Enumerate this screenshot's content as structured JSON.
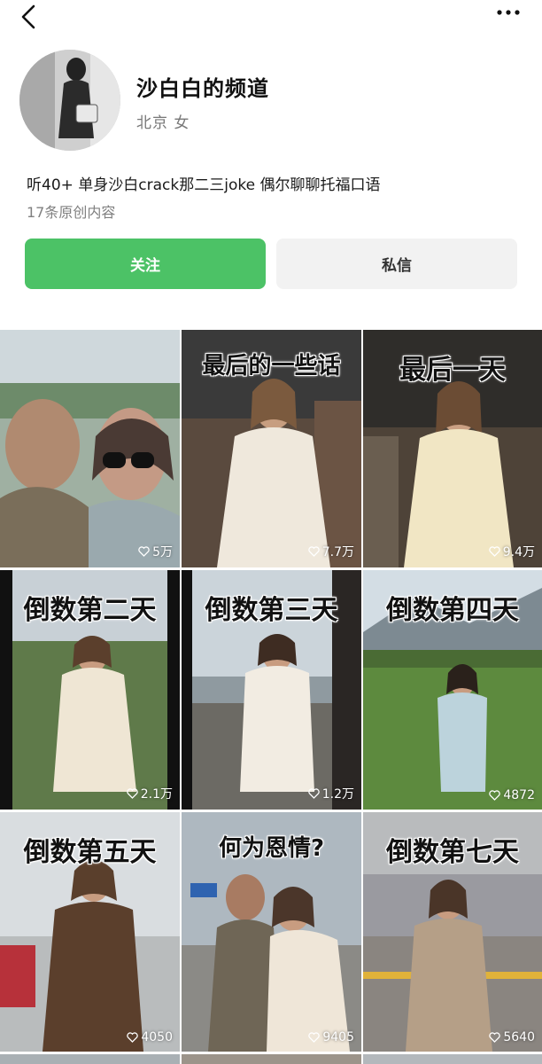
{
  "profile": {
    "channel_name": "沙白白的频道",
    "location": "北京 女",
    "bio": "听40+ 单身沙白crack那二三joke 偶尔聊聊托福口语",
    "content_count": "17条原创内容",
    "follow_label": "关注",
    "message_label": "私信"
  },
  "colors": {
    "follow": "#4cc266",
    "message_bg": "#f2f2f2"
  },
  "videos": [
    {
      "caption": "",
      "likes": "5万"
    },
    {
      "caption": "最后的一些话",
      "likes": "7.7万"
    },
    {
      "caption": "最后一天",
      "likes": "9.4万"
    },
    {
      "caption": "倒数第二天",
      "likes": "2.1万"
    },
    {
      "caption": "倒数第三天",
      "likes": "1.2万"
    },
    {
      "caption": "倒数第四天",
      "likes": "4872"
    },
    {
      "caption": "倒数第五天",
      "likes": "4050"
    },
    {
      "caption": "何为恩情?",
      "likes": "9405"
    },
    {
      "caption": "倒数第七天",
      "likes": "5640"
    }
  ],
  "icons": [
    "back-arrow-icon",
    "more-dots-icon",
    "heart-icon"
  ]
}
